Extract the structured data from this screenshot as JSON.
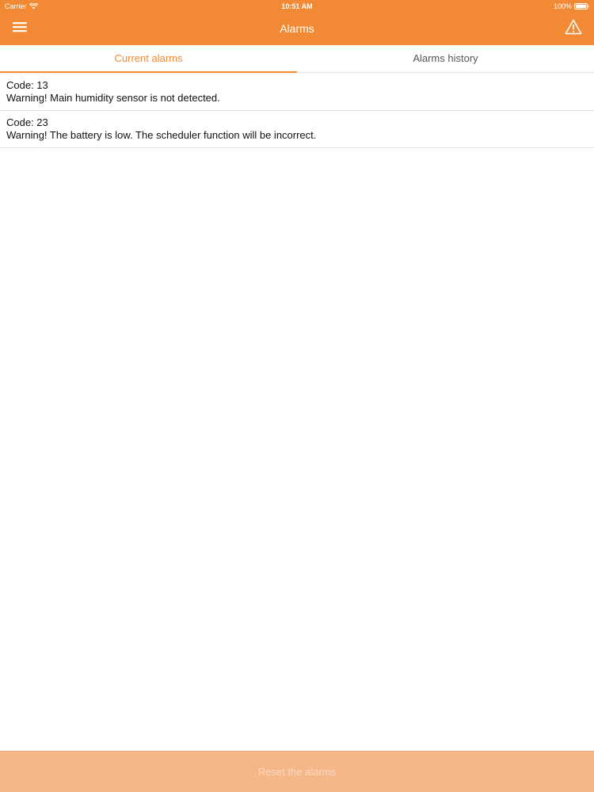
{
  "status_bar": {
    "carrier": "Carrier",
    "time": "10:51 AM",
    "battery": "100%"
  },
  "nav": {
    "title": "Alarms",
    "menu_icon": "hamburger-menu-icon",
    "alarm_icon": "warning-triangle-icon"
  },
  "tabs": [
    {
      "label": "Current alarms",
      "active": true
    },
    {
      "label": "Alarms history",
      "active": false
    }
  ],
  "alarms": [
    {
      "code": "Code: 13",
      "message": "Warning! Main humidity sensor is not detected."
    },
    {
      "code": "Code: 23",
      "message": "Warning! The battery is low. The scheduler function will be incorrect."
    }
  ],
  "footer": {
    "reset_label": "Reset the alarms"
  },
  "colors": {
    "accent": "#f28a35",
    "button_disabled_bg": "#f5b688",
    "button_disabled_text": "#fbd9c2"
  }
}
